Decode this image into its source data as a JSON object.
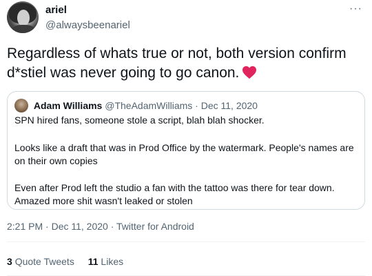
{
  "author": {
    "display_name": "ariel",
    "handle": "@alwaysbeenariel"
  },
  "more_icon": "···",
  "tweet_text": "Regardless of whats true or not, both version confirm d*stiel was never going to go canon.",
  "heart_emoji": {
    "icon": "red-heart-icon",
    "color": "#e0245e"
  },
  "quoted_tweet": {
    "display_name": "Adam Williams",
    "handle": "@TheAdamWilliams",
    "separator": "·",
    "date": "Dec 11, 2020",
    "paragraphs": [
      "SPN hired fans, someone stole a script, blah blah shocker.",
      "Looks like a draft that was in Prod Office by the watermark. People's names are on their own copies",
      "Even after Prod left the studio a fan with the tattoo was there for tear down. Amazed more shit wasn't leaked or stolen"
    ]
  },
  "timestamp": "2:21 PM · Dec 11, 2020 · Twitter for Android",
  "stats": {
    "quote_tweets_count": "3",
    "quote_tweets_label": "Quote Tweets",
    "likes_count": "11",
    "likes_label": "Likes"
  }
}
